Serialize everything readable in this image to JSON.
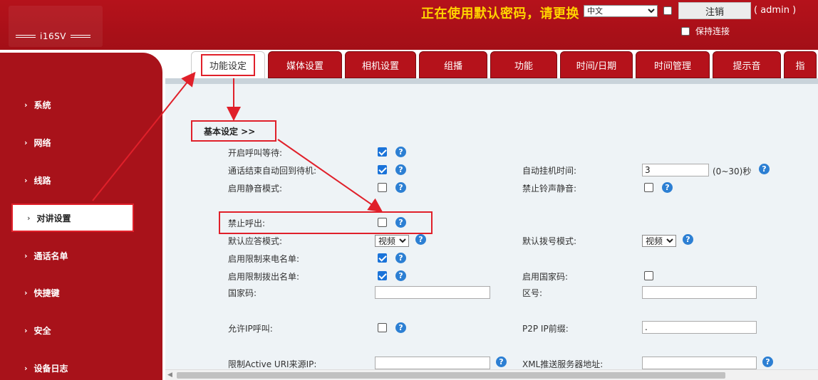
{
  "header": {
    "model": "i16SV",
    "warning": "正在使用默认密码，请更换",
    "language": "中文",
    "logout_label": "注销",
    "user": "( admin )",
    "keep_connected": "保持连接"
  },
  "sidebar": {
    "items": [
      {
        "label": "系统"
      },
      {
        "label": "网络"
      },
      {
        "label": "线路"
      },
      {
        "label": "对讲设置"
      },
      {
        "label": "通话名单"
      },
      {
        "label": "快捷键"
      },
      {
        "label": "安全"
      },
      {
        "label": "设备日志"
      }
    ]
  },
  "tabs": [
    {
      "label": "功能设定"
    },
    {
      "label": "媒体设置"
    },
    {
      "label": "相机设置"
    },
    {
      "label": "组播"
    },
    {
      "label": "功能"
    },
    {
      "label": "时间/日期"
    },
    {
      "label": "时间管理"
    },
    {
      "label": "提示音"
    },
    {
      "label": "指"
    }
  ],
  "section": {
    "title": "基本设定 >>"
  },
  "settings": {
    "call_waiting": "开启呼叫等待:",
    "auto_standby": "通话结束自动回到待机:",
    "auto_hangup_time": "自动挂机时间:",
    "auto_hangup_value": "3",
    "auto_hangup_range": "(0~30)秒",
    "silent_mode": "启用静音模式:",
    "disable_ring_mute": "禁止铃声静音:",
    "disable_outgoing": "禁止呼出:",
    "default_answer_mode": "默认应答模式:",
    "default_answer_value": "视频",
    "default_dial_mode": "默认拨号模式:",
    "default_dial_value": "视频",
    "restrict_incoming": "启用限制来电名单:",
    "restrict_outgoing": "启用限制拨出名单:",
    "enable_country_code": "启用国家码:",
    "country_code": "国家码:",
    "area_code": "区号:",
    "allow_ip_call": "允许IP呼叫:",
    "p2p_ip_prefix": "P2P IP前缀:",
    "p2p_ip_prefix_value": ".",
    "restrict_active_uri": "限制Active URI来源IP:",
    "xml_push_server": "XML推送服务器地址:"
  },
  "help_symbol": "?",
  "colors": {
    "brand_red": "#b5121b",
    "highlight_red": "#e0202a",
    "checkbox_blue": "#1a73d9"
  }
}
